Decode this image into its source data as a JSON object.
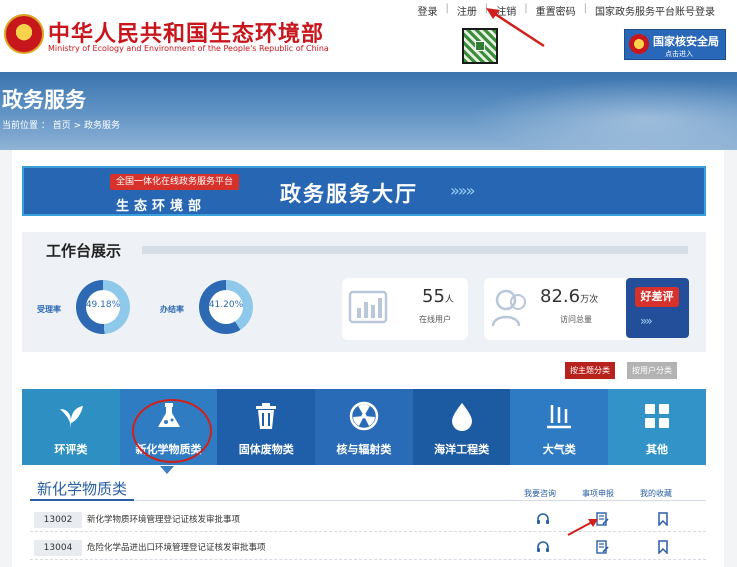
{
  "header": {
    "ministry_cn": "中华人民共和国生态环境部",
    "ministry_en": "Ministry of Ecology and Environment of the People's Republic of China",
    "top_links": [
      "登录",
      "注册",
      "注销",
      "重置密码",
      "国家政务服务平台账号登录"
    ],
    "nsa_title": "国家核安全局",
    "nsa_sub": "点击进入"
  },
  "banner": {
    "heading": "政务服务",
    "breadcrumb": "当前位置 ： 首页 > 政务服务"
  },
  "hall": {
    "badge": "全国一体化在线政务服务平台",
    "subtitle": "生态环境部",
    "title": "政务服务大厅",
    "arrows": "»»»"
  },
  "workbench": {
    "title": "工作台展示",
    "acceptance": {
      "label": "受理率",
      "value": "49.18%",
      "fraction": 0.4918
    },
    "completion": {
      "label": "办结率",
      "value": "41.20%",
      "fraction": 0.412
    },
    "online_users": {
      "number": "55",
      "unit": "人",
      "label": "在线用户"
    },
    "total_visits": {
      "number": "82.6",
      "unit": "万次",
      "label": "访问总量"
    },
    "evaluation": {
      "label": "好差评",
      "arrows": "»»"
    }
  },
  "classification": {
    "by_topic": "按主题分类",
    "by_user": "按用户分类"
  },
  "categories": [
    {
      "label": "环评类",
      "icon": "leaf-icon"
    },
    {
      "label": "新化学物质类",
      "icon": "flask-icon"
    },
    {
      "label": "固体废物类",
      "icon": "trash-icon"
    },
    {
      "label": "核与辐射类",
      "icon": "radiation-icon"
    },
    {
      "label": "海洋工程类",
      "icon": "water-drop-icon"
    },
    {
      "label": "大气类",
      "icon": "air-icon"
    },
    {
      "label": "其他",
      "icon": "grid-icon"
    }
  ],
  "section": {
    "title": "新化学物质类",
    "columns": [
      "我要咨询",
      "事项申报",
      "我的收藏"
    ]
  },
  "items": [
    {
      "code": "13002",
      "name": "新化学物质环境管理登记证核发审批事项"
    },
    {
      "code": "13004",
      "name": "危险化学品进出口环境管理登记证核发审批事项"
    }
  ],
  "colors": {
    "brand_red": "#c8161d",
    "tab_blue": "#2269b5",
    "accent_dark_blue": "#234f9a"
  }
}
